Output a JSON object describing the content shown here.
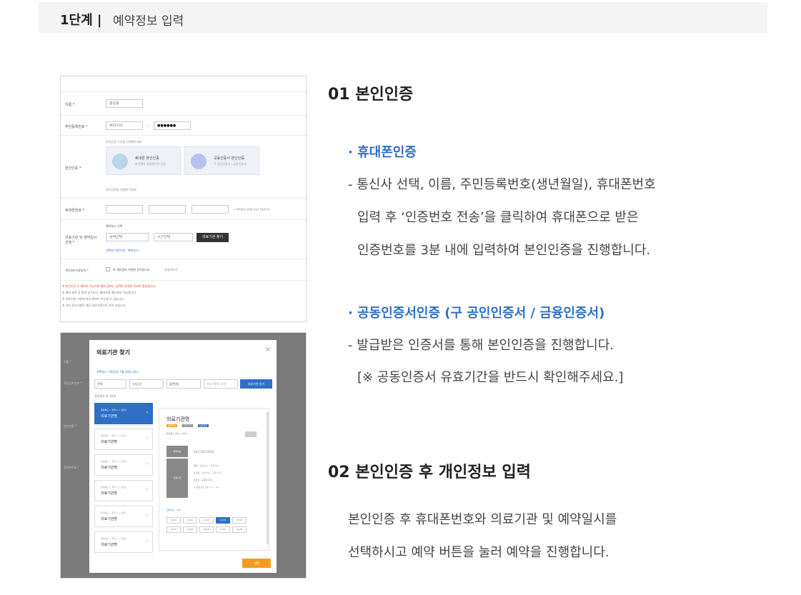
{
  "step": {
    "number": "1단계 |",
    "title": "예약정보 입력"
  },
  "form_screenshot": {
    "labels": [
      "이름 *",
      "주민등록번호 *",
      "본인인증 *",
      "휴대폰번호 *",
      "의료기관 및 예약일시 선택 *",
      "개인정보이용동의 *"
    ],
    "name_value": "홍길동",
    "rrn_front": "900101",
    "rrn_back": "●●●●●●",
    "auth_hint": "본인인증 수단을 선택해주세요",
    "auth_options": [
      {
        "title": "휴대폰 본인인증",
        "desc": "본인명의 휴대폰으로 인증"
      },
      {
        "title": "공동인증서 본인인증",
        "desc": "구 공인인증서 / 금융인증서"
      }
    ],
    "auth_notice": "본인인증을 진행해 주세요",
    "phone_hint": "※ 예약정보는 휴대폰 번호로 전송됩니다.",
    "select_date_label": "예약일시 선택",
    "date_placeholder": "날짜선택",
    "time_placeholder": "시간선택",
    "find_button": "의료기관 찾기",
    "selected_info": "선택한 의료기관 : 예약일시 :",
    "consent_label": "위 개인정보 이용에 동의합니다.",
    "consent_button": "자세히보기",
    "notices": [
      "※ 본인인증 후 예약이 가능하며 예약 정보는 입력한 휴대폰 번호로 발송됩니다.",
      "※ 예약 완료 후 변경 및 취소는 예약조회 메뉴에서 가능합니다.",
      "※ 의료기관 사정에 따라 예약이 취소될 수 있습니다.",
      "※ 기타 문의사항은 해당 의료기관으로 연락 바랍니다."
    ]
  },
  "modal_screenshot": {
    "title": "의료기관 찾기",
    "close": "×",
    "date_info": "선택일시: 2023년 7월 20일 14시",
    "selects": [
      "전체",
      "시/군/구",
      "읍/면/동"
    ],
    "search_placeholder": "의료기관명 입력",
    "search_button": "의료기관 찾기",
    "result_count": "검색결과 총 20개",
    "hospitals": [
      {
        "addr": "충청북도 > 청주시 > 상당구",
        "name": "의료기관명",
        "active": true
      },
      {
        "addr": "충청북도 > 청주시 > 상당구",
        "name": "의료기관명",
        "active": false
      },
      {
        "addr": "충청북도 > 청주시 > 상당구",
        "name": "의료기관명",
        "active": false
      },
      {
        "addr": "충청북도 > 청주시 > 상당구",
        "name": "의료기관명",
        "active": false
      },
      {
        "addr": "충청북도 > 청주시 > 상당구",
        "name": "의료기관명",
        "active": false
      },
      {
        "addr": "충청북도 > 청주시 > 상당구",
        "name": "의료기관명",
        "active": false
      }
    ],
    "detail_name": "의료기관명",
    "detail_tags": [
      "예약가능",
      "검진기관",
      "야간진료"
    ],
    "detail_addr": "충청북도 청주시 상당구",
    "detail_phone_label": "전화번호",
    "detail_phone": "043-200-0000",
    "detail_hours_label": "진료시간",
    "detail_hours": [
      "평일 : 오전 9시 ~ 오후 6시",
      "토요일 : 오전 9시 ~ 오후 1시",
      "일요일 · 공휴일 휴무",
      "※ 점심시간 오후 1시 ~ 2시"
    ],
    "time_label": "선택시간 : 14시",
    "time_slots": [
      "09:00",
      "10:00",
      "11:00",
      "14:00",
      "15:00",
      "16:00",
      "17:00",
      "18:00",
      "19:00",
      "20:00"
    ],
    "select_button": "선택"
  },
  "section1": {
    "title": "01 본인인증",
    "phone_title": "· 휴대폰인증",
    "phone_lines": [
      "- 통신사 선택, 이름, 주민등록번호(생년월일), 휴대폰번호",
      "입력 후 ‘인증번호 전송’을 클릭하여 휴대폰으로 받은",
      "인증번호를 3분 내에 입력하여 본인인증을 진행합니다."
    ],
    "cert_title": "· 공동인증서인증 (구 공인인증서 / 금융인증서)",
    "cert_lines": [
      "- 발급받은 인증서를 통해 본인인증을 진행합니다.",
      "[※ 공동인증서 유효기간을 반드시 확인해주세요.]"
    ]
  },
  "section2": {
    "title": "02 본인인증 후 개인정보 입력",
    "lines": [
      "본인인증 후 휴대폰번호와 의료기관 및 예약일시를",
      "선택하시고 예약 버튼을 눌러 예약을 진행합니다."
    ]
  },
  "colors": {
    "accent": "#2f6fc4",
    "orange": "#f39c1f",
    "notice_red": "#e2412f"
  }
}
